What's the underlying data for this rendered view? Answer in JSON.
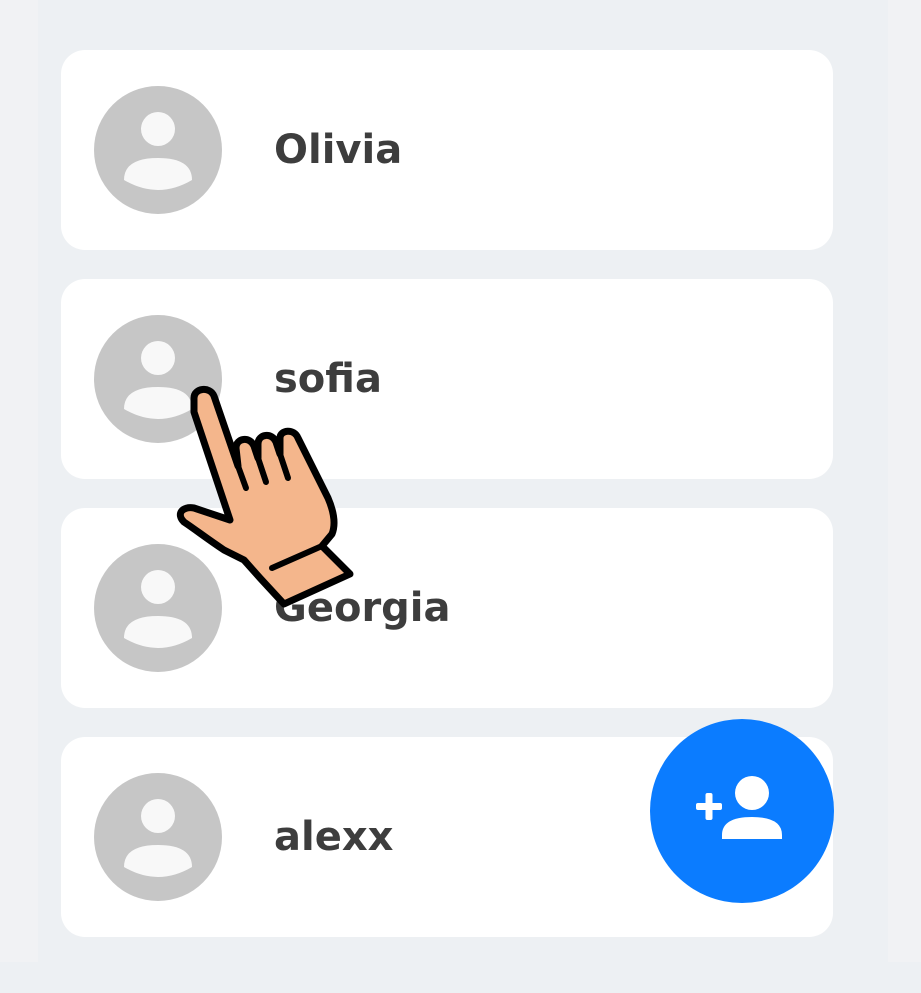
{
  "contacts": [
    {
      "name": "Olivia"
    },
    {
      "name": "sofia"
    },
    {
      "name": "Georgia"
    },
    {
      "name": "alexx"
    }
  ],
  "icons": {
    "avatar": "person-placeholder-icon",
    "fab": "add-person-icon",
    "pointer": "pointing-hand-icon"
  },
  "colors": {
    "accent": "#0b7cff",
    "avatar_bg": "#c6c6c6",
    "avatar_fg": "#f8f8f8",
    "text": "#3d3d3d",
    "card": "#ffffff",
    "background": "#edf0f3",
    "hand_fill": "#f4b68c"
  }
}
